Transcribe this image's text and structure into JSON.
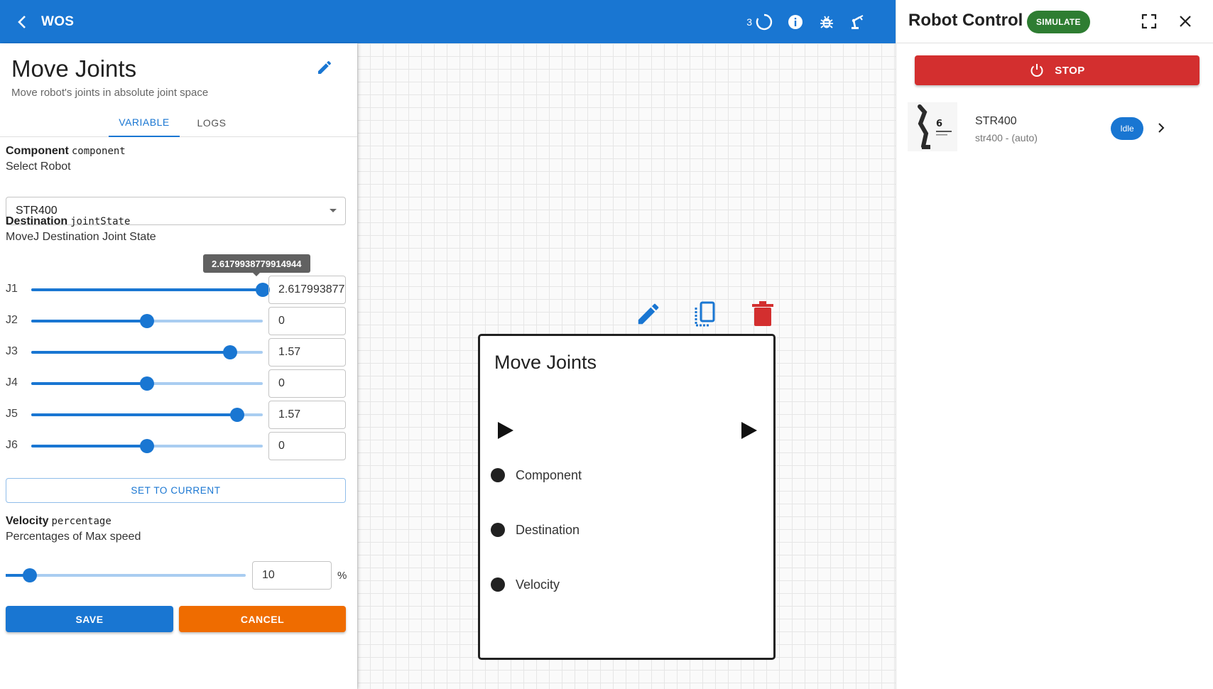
{
  "appbar": {
    "title": "WOS",
    "task_count": "3",
    "background_color": "#1976d2"
  },
  "editor": {
    "title": "Move Joints",
    "subtitle": "Move robot's joints in absolute joint space",
    "tabs": [
      {
        "label": "VARIABLE",
        "active": true
      },
      {
        "label": "LOGS",
        "active": false
      }
    ],
    "component": {
      "label": "Component",
      "code": "component",
      "description": "Select Robot",
      "selected": "STR400"
    },
    "destination": {
      "label": "Destination",
      "code": "jointState",
      "description": "MoveJ Destination Joint State",
      "tooltip": "2.6179938779914944",
      "joints": [
        {
          "label": "J1",
          "value": "2.6179938779914944",
          "fraction": 1.0
        },
        {
          "label": "J2",
          "value": "0",
          "fraction": 0.5
        },
        {
          "label": "J3",
          "value": "1.57",
          "fraction": 0.86
        },
        {
          "label": "J4",
          "value": "0",
          "fraction": 0.5
        },
        {
          "label": "J5",
          "value": "1.57",
          "fraction": 0.89
        },
        {
          "label": "J6",
          "value": "0",
          "fraction": 0.5
        }
      ],
      "set_to_current_label": "SET TO CURRENT"
    },
    "velocity": {
      "label": "Velocity",
      "code": "percentage",
      "description": "Percentages of Max speed",
      "value": "10",
      "fraction": 0.1,
      "unit": "%"
    },
    "save_label": "SAVE",
    "cancel_label": "CANCEL"
  },
  "node": {
    "title": "Move Joints",
    "ports": [
      "Component",
      "Destination",
      "Velocity"
    ]
  },
  "robot_control": {
    "title": "Robot Control",
    "mode_badge": "SIMULATE",
    "stop_label": "STOP",
    "robot": {
      "name": "STR400",
      "subtitle": "str400 - (auto)",
      "status": "Idle"
    }
  },
  "icons": {
    "back": "chevron-left-icon",
    "spinner": "loading-spinner-icon",
    "info": "info-icon",
    "debug": "bug-icon",
    "robot_arm": "robot-arm-icon",
    "edit": "pencil-icon",
    "copy": "copy-icon",
    "delete": "trash-icon",
    "expand": "fullscreen-icon",
    "close": "close-icon",
    "power": "power-icon",
    "chevron": "chevron-right-icon"
  },
  "colors": {
    "primary": "#1976d2",
    "cancel": "#ef6c00",
    "stop": "#d32f2f",
    "simulate": "#2e7d32"
  }
}
